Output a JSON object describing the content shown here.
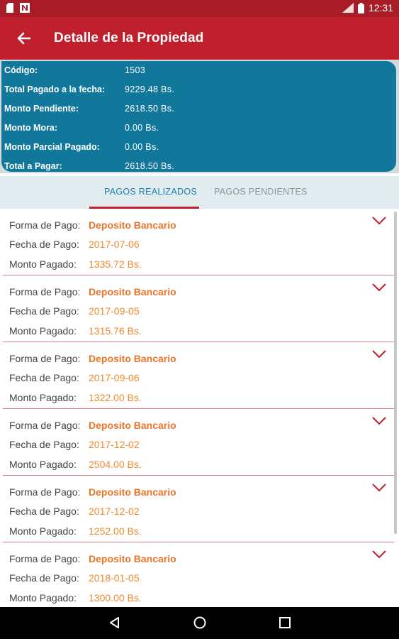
{
  "status_bar": {
    "time": "12:31"
  },
  "app_bar": {
    "title": "Detalle de la Propiedad"
  },
  "summary": [
    {
      "label": "Código:",
      "value": "1503"
    },
    {
      "label": "Total Pagado a la fecha:",
      "value": "9229.48 Bs."
    },
    {
      "label": "Monto Pendiente:",
      "value": "2618.50 Bs."
    },
    {
      "label": "Monto Mora:",
      "value": "0.00 Bs."
    },
    {
      "label": "Monto Parcial Pagado:",
      "value": "0.00 Bs."
    },
    {
      "label": "Total a Pagar:",
      "value": "2618.50 Bs."
    }
  ],
  "tabs": [
    {
      "label": "PAGOS REALIZADOS"
    },
    {
      "label": "PAGOS PENDIENTES"
    }
  ],
  "payments": [
    {
      "forma_label": "Forma de Pago:",
      "forma": "Deposito Bancario",
      "fecha_label": "Fecha de Pago:",
      "fecha": "2017-07-06",
      "monto_label": "Monto Pagado:",
      "monto": "1335.72 Bs."
    },
    {
      "forma_label": "Forma de Pago:",
      "forma": "Deposito Bancario",
      "fecha_label": "Fecha de Pago:",
      "fecha": "2017-09-05",
      "monto_label": "Monto Pagado:",
      "monto": "1315.76 Bs."
    },
    {
      "forma_label": "Forma de Pago:",
      "forma": "Deposito Bancario",
      "fecha_label": "Fecha de Pago:",
      "fecha": "2017-09-06",
      "monto_label": "Monto Pagado:",
      "monto": "1322.00 Bs."
    },
    {
      "forma_label": "Forma de Pago:",
      "forma": "Deposito Bancario",
      "fecha_label": "Fecha de Pago:",
      "fecha": "2017-12-02",
      "monto_label": "Monto Pagado:",
      "monto": "2504.00 Bs."
    },
    {
      "forma_label": "Forma de Pago:",
      "forma": "Deposito Bancario",
      "fecha_label": "Fecha de Pago:",
      "fecha": "2017-12-02",
      "monto_label": "Monto Pagado:",
      "monto": "1252.00 Bs."
    },
    {
      "forma_label": "Forma de Pago:",
      "forma": "Deposito Bancario",
      "fecha_label": "Fecha de Pago:",
      "fecha": "2018-01-05",
      "monto_label": "Monto Pagado:",
      "monto": "1300.00 Bs."
    }
  ],
  "icons": {
    "back": "arrow-left-icon",
    "expand": "chevron-down-icon",
    "nav_back": "triangle-back-icon",
    "nav_home": "circle-home-icon",
    "nav_recents": "square-recents-icon"
  },
  "colors": {
    "status_bar": "#a71c27",
    "app_bar": "#c0202d",
    "summary_card": "#11789c",
    "tab_active": "#1b7fb0",
    "value_orange": "#f08a2e",
    "divider": "#d77b84"
  }
}
